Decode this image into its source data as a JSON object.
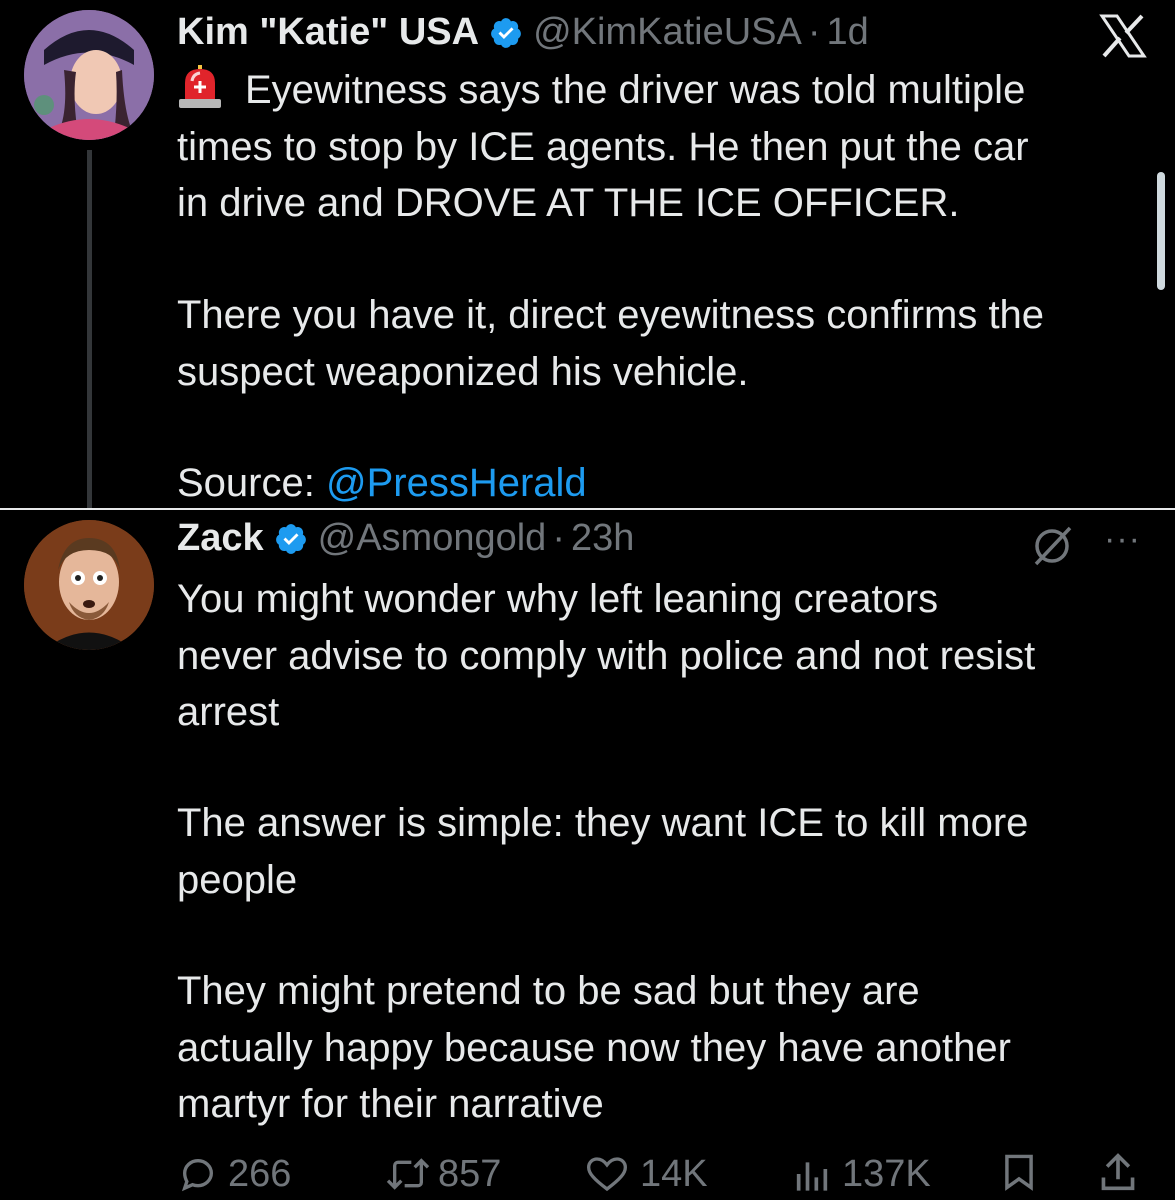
{
  "tweet1": {
    "display_name": "Kim \"Katie\" USA",
    "handle": "@KimKatieUSA",
    "separator": "·",
    "time": "1d",
    "alert_emoji": "🚨",
    "text_line1_rest": "Eyewitness says the driver was told multiple",
    "text_line2": "times to stop by ICE agents.  He then put the car",
    "text_line3": "in drive and DROVE AT THE ICE OFFICER.",
    "text_para2_line1": "There you have it, direct eyewitness confirms the",
    "text_para2_line2": "suspect weaponized his vehicle.",
    "source_label": "Source: ",
    "source_link": "@PressHerald",
    "avatar_icon": "avatar-image",
    "verified_icon": "verified-badge-icon",
    "corner_logo": "x-logo-icon"
  },
  "tweet2": {
    "display_name": "Zack",
    "handle": "@Asmongold",
    "separator": "·",
    "time": "23h",
    "para1_line1": "You might wonder why left leaning creators",
    "para1_line2": "never advise to comply with police and not resist",
    "para1_line3": "arrest",
    "para2_line1": "The answer is simple: they want ICE to kill more",
    "para2_line2": "people",
    "para3_line1": "They might pretend to be sad but they are",
    "para3_line2": "actually happy because now they have another",
    "para3_line3": "martyr for their narrative",
    "more_label": "···",
    "actions": {
      "replies": "266",
      "reposts": "857",
      "likes": "14K",
      "views": "137K"
    }
  },
  "colors": {
    "background": "#000000",
    "text": "#e7e9ea",
    "secondary": "#71767b",
    "link": "#1d9bf0",
    "verified": "#1d9bf0"
  }
}
